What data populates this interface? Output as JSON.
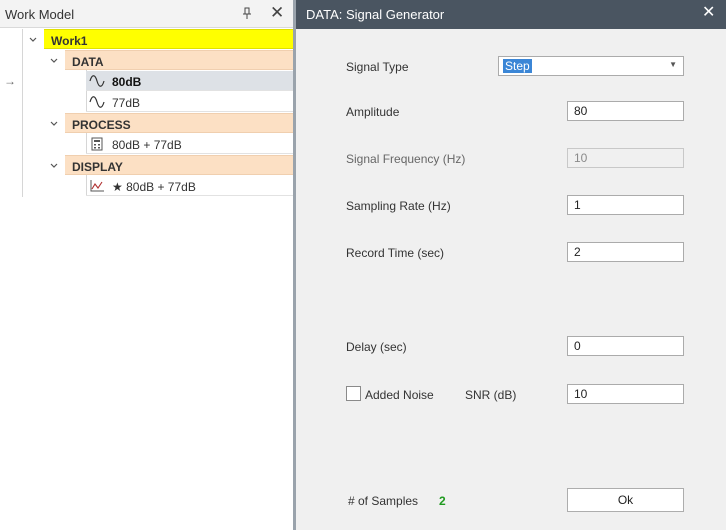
{
  "work_model": {
    "title": "Work Model",
    "pin_icon": "pin-icon",
    "close_icon": "close-icon",
    "tree": {
      "root": "Work1",
      "data_label": "DATA",
      "data_items": [
        "80dB",
        "77dB"
      ],
      "process_label": "PROCESS",
      "process_items": [
        "80dB + 77dB"
      ],
      "display_label": "DISPLAY",
      "display_items": [
        "★ 80dB + 77dB"
      ]
    },
    "indicator": "→"
  },
  "dialog": {
    "title": "DATA: Signal Generator",
    "close_glyph": "✕",
    "signal_type_label": "Signal Type",
    "signal_type_value": "Step",
    "amplitude_label": "Amplitude",
    "amplitude_value": "80",
    "signal_frequency_label": "Signal Frequency (Hz)",
    "signal_frequency_value": "10",
    "sampling_rate_label": "Sampling Rate (Hz)",
    "sampling_rate_value": "1",
    "record_time_label": "Record Time (sec)",
    "record_time_value": "2",
    "delay_label": "Delay (sec)",
    "delay_value": "0",
    "added_noise_label": "Added Noise",
    "added_noise_checked": false,
    "snr_label": "SNR (dB)",
    "snr_value": "10",
    "samples_label": "# of Samples",
    "samples_value": "2",
    "ok_label": "Ok"
  },
  "colors": {
    "root_highlight": "#ffff00",
    "category_bg": "#fce0c4",
    "header_bg": "#4a5561",
    "selected_row": "#dde1e6",
    "samples_value": "#1f9a1f"
  }
}
